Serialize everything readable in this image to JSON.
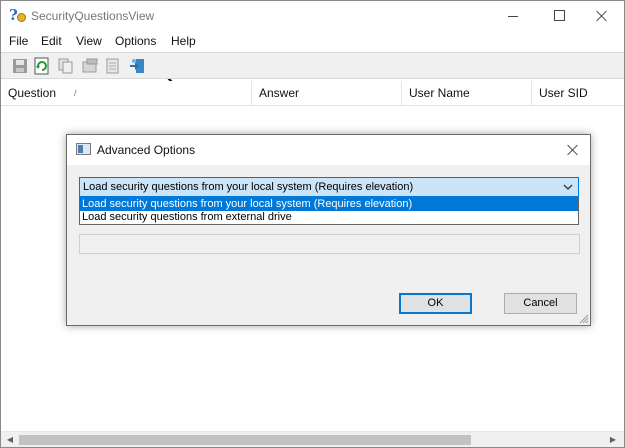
{
  "window": {
    "title": "SecurityQuestionsView",
    "controls": {
      "minimize": "minimize",
      "maximize": "maximize",
      "close": "close"
    }
  },
  "menu": {
    "items": [
      "File",
      "Edit",
      "View",
      "Options",
      "Help"
    ]
  },
  "toolbar": {
    "buttons": [
      "save-icon",
      "refresh-icon",
      "copy-icon",
      "properties-icon",
      "html-report-icon",
      "exit-icon"
    ]
  },
  "list": {
    "columns": [
      "Question",
      "Answer",
      "User Name",
      "User SID"
    ],
    "sort_indicator": "/"
  },
  "dialog": {
    "title": "Advanced Options",
    "source_select": {
      "selected": "Load security questions from your local system (Requires elevation)",
      "options": [
        "Load security questions from your local system (Requires elevation)",
        "Load security questions from external drive"
      ]
    },
    "ok_label": "OK",
    "cancel_label": "Cancel"
  },
  "colors": {
    "accent": "#0078d7",
    "combo_bg": "#cce4f7",
    "dialog_bg": "#f0f0f0"
  }
}
